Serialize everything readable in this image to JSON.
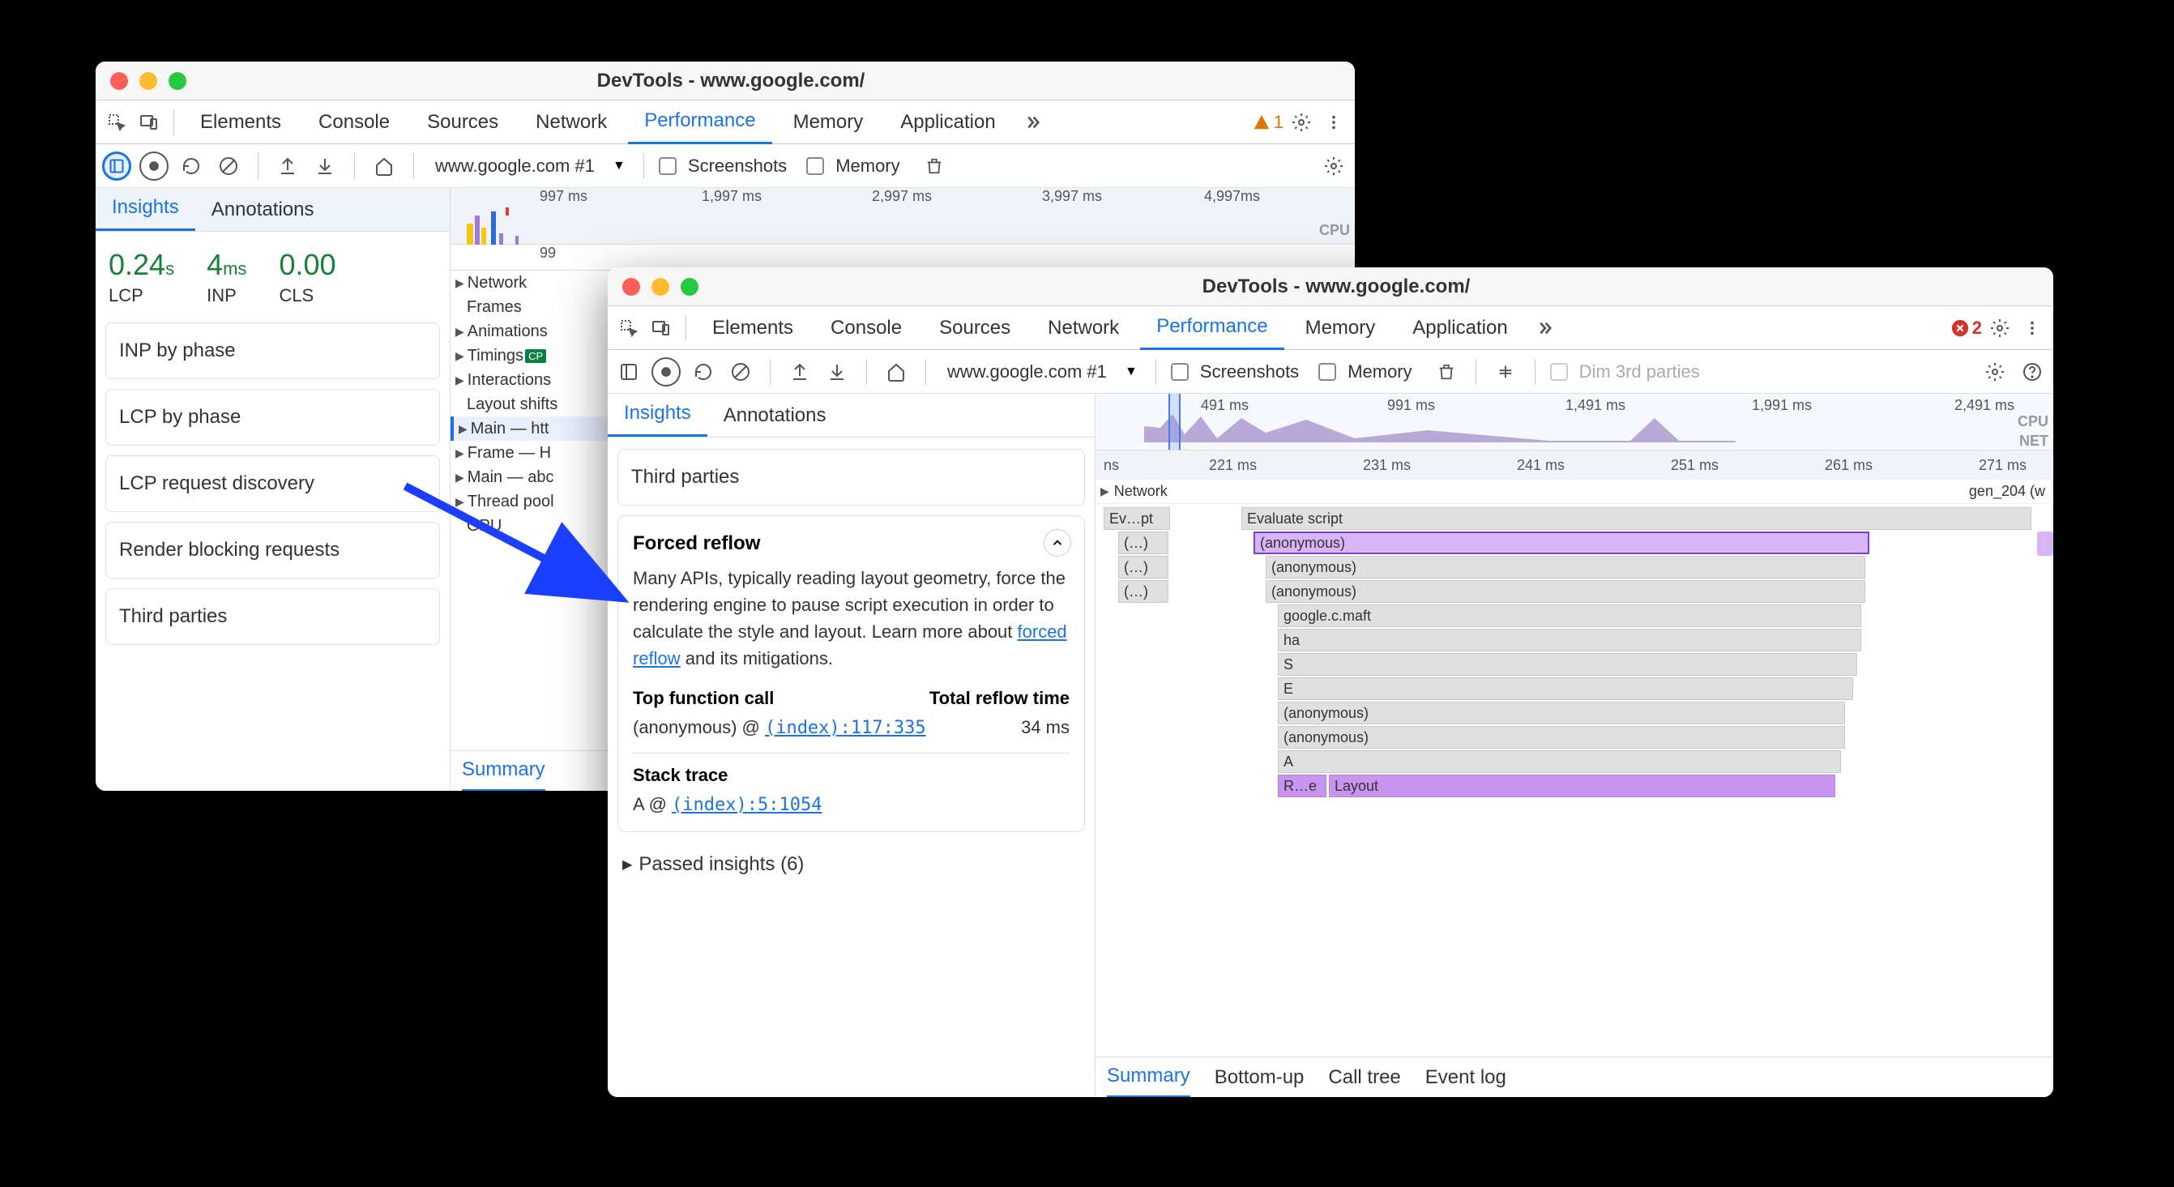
{
  "window1": {
    "title": "DevTools - www.google.com/",
    "tabs": [
      "Elements",
      "Console",
      "Sources",
      "Network",
      "Performance",
      "Memory",
      "Application"
    ],
    "active_tab": "Performance",
    "warn_count": "1",
    "record_url": "www.google.com #1",
    "checkboxes": [
      "Screenshots",
      "Memory"
    ],
    "sidebar_tabs": [
      "Insights",
      "Annotations"
    ],
    "metrics": [
      {
        "value": "0.24",
        "unit": "s",
        "label": "LCP"
      },
      {
        "value": "4",
        "unit": "ms",
        "label": "INP"
      },
      {
        "value": "0.00",
        "unit": "",
        "label": "CLS"
      }
    ],
    "insights": [
      "INP by phase",
      "LCP by phase",
      "LCP request discovery",
      "Render blocking requests",
      "Third parties"
    ],
    "ruler": [
      "997 ms",
      "1,997 ms",
      "2,997 ms",
      "3,997 ms",
      "4,997ms"
    ],
    "cpu": "CPU",
    "ruler2": "99",
    "tracks": [
      "Network",
      "Frames",
      "Animations",
      "Timings",
      "Interactions",
      "Layout shifts",
      "Main — htt",
      "Frame — H",
      "Main — abc",
      "Thread pool",
      "GPU"
    ],
    "footer": [
      "Summary"
    ]
  },
  "window2": {
    "title": "DevTools - www.google.com/",
    "tabs": [
      "Elements",
      "Console",
      "Sources",
      "Network",
      "Performance",
      "Memory",
      "Application"
    ],
    "active_tab": "Performance",
    "err_count": "2",
    "record_url": "www.google.com #1",
    "checkboxes": [
      "Screenshots",
      "Memory"
    ],
    "dim_label": "Dim 3rd parties",
    "sidebar_tabs": [
      "Insights",
      "Annotations"
    ],
    "third_parties": "Third parties",
    "detail": {
      "title": "Forced reflow",
      "body_prefix": "Many APIs, typically reading layout geometry, force the rendering engine to pause script execution in order to calculate the style and layout. Learn more about ",
      "link_text": "forced reflow",
      "body_suffix": " and its mitigations.",
      "col1": "Top function call",
      "col2": "Total reflow time",
      "row1_fn": "(anonymous) @ ",
      "row1_link": "(index):117:335",
      "row1_time": "34 ms",
      "stack_title": "Stack trace",
      "stack_fn": "A @ ",
      "stack_link": "(index):5:1054"
    },
    "passed": "Passed insights (6)",
    "overview_ticks": [
      "491 ms",
      "991 ms",
      "1,491 ms",
      "1,991 ms",
      "2,491 ms"
    ],
    "overview_labels": [
      "CPU",
      "NET"
    ],
    "ruler": [
      "ns",
      "221 ms",
      "231 ms",
      "241 ms",
      "251 ms",
      "261 ms",
      "271 ms"
    ],
    "net_label": "Network",
    "net_item": "gen_204 (w",
    "flame": {
      "col0": [
        "Ev…pt",
        "(…)",
        "(…)",
        "(…)"
      ],
      "rows": [
        "Evaluate script",
        "(anonymous)",
        "(anonymous)",
        "(anonymous)",
        "google.c.maft",
        "ha",
        "S",
        "E",
        "(anonymous)",
        "(anonymous)",
        "A",
        "R…e",
        "Layout"
      ]
    },
    "footer": [
      "Summary",
      "Bottom-up",
      "Call tree",
      "Event log"
    ]
  }
}
